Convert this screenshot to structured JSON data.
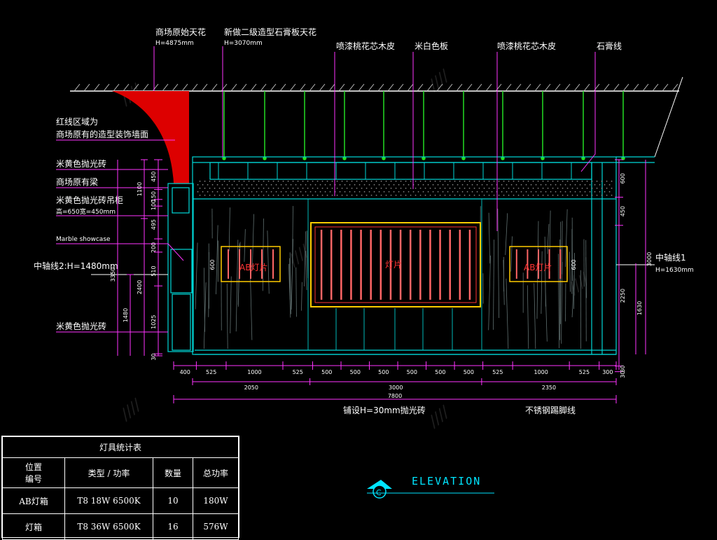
{
  "labels": {
    "ceiling_original": "商场原始天花",
    "ceiling_original_h": "H=4875mm",
    "ceiling_new": "新做二级造型石膏板天花",
    "ceiling_new_h": "H=3070mm",
    "veneer_left": "喷漆桃花芯木皮",
    "beige_panel": "米白色板",
    "veneer_right": "喷漆桃花芯木皮",
    "plaster_line": "石膏线",
    "red_zone_1": "红线区域为",
    "red_zone_2": "商场原有的造型装饰墙面",
    "beige_tile_top": "米黄色抛光砖",
    "beam": "商场原有梁",
    "beige_tile_hang": "米黄色抛光砖吊柜",
    "beige_tile_hang_size": "高=650宽=450mm",
    "marble": "Marble showcase",
    "axis2": "中轴线2:H=1480mm",
    "beige_tile_bottom": "米黄色抛光砖",
    "axis1": "中轴线1",
    "axis1_h": "H=1630mm",
    "lightbox_left": "AB灯片",
    "lightbox_center": "灯片",
    "lightbox_right": "AB灯片",
    "floor_tile": "铺设H=30mm抛光砖",
    "steel_skirting": "不锈钢踢脚线",
    "title": "ELEVATION",
    "symbol": "C"
  },
  "dimensions": {
    "bottom_row1": [
      "400",
      "525",
      "1000",
      "525",
      "500",
      "500",
      "500",
      "500",
      "500",
      "500",
      "525",
      "1000",
      "525",
      "300"
    ],
    "bottom_row2": [
      "2050",
      "3000",
      "2350"
    ],
    "bottom_total": "7800",
    "left_stack": [
      "450",
      "150",
      "100",
      "495",
      "200",
      "510",
      "1025",
      "30"
    ],
    "left_mid": [
      "1100",
      "2400",
      "1480"
    ],
    "left_total": "3350",
    "right_stack": [
      "600",
      "450",
      "2250",
      "30",
      "30"
    ],
    "right_mid": [
      "1630",
      "3000"
    ],
    "lightbox_height": "600"
  },
  "legend": {
    "caption": "灯具统计表",
    "headers": [
      "位置\n编号",
      "类型 / 功率",
      "数量",
      "总功率"
    ],
    "rows": [
      [
        "AB灯箱",
        "T8 18W 6500K",
        "10",
        "180W"
      ],
      [
        "灯箱",
        "T8 36W 6500K",
        "16",
        "576W"
      ]
    ]
  },
  "colors": {
    "background": "#000000",
    "outline": "#00d8d8",
    "leader": "#ff33ff",
    "hanger": "#22dd22",
    "lightbox_frame": "#ffcc00",
    "lightbox_tube": "#ff6666",
    "red_zone": "#dd0000",
    "dimension": "#ff33ff",
    "text": "#ffffff"
  }
}
